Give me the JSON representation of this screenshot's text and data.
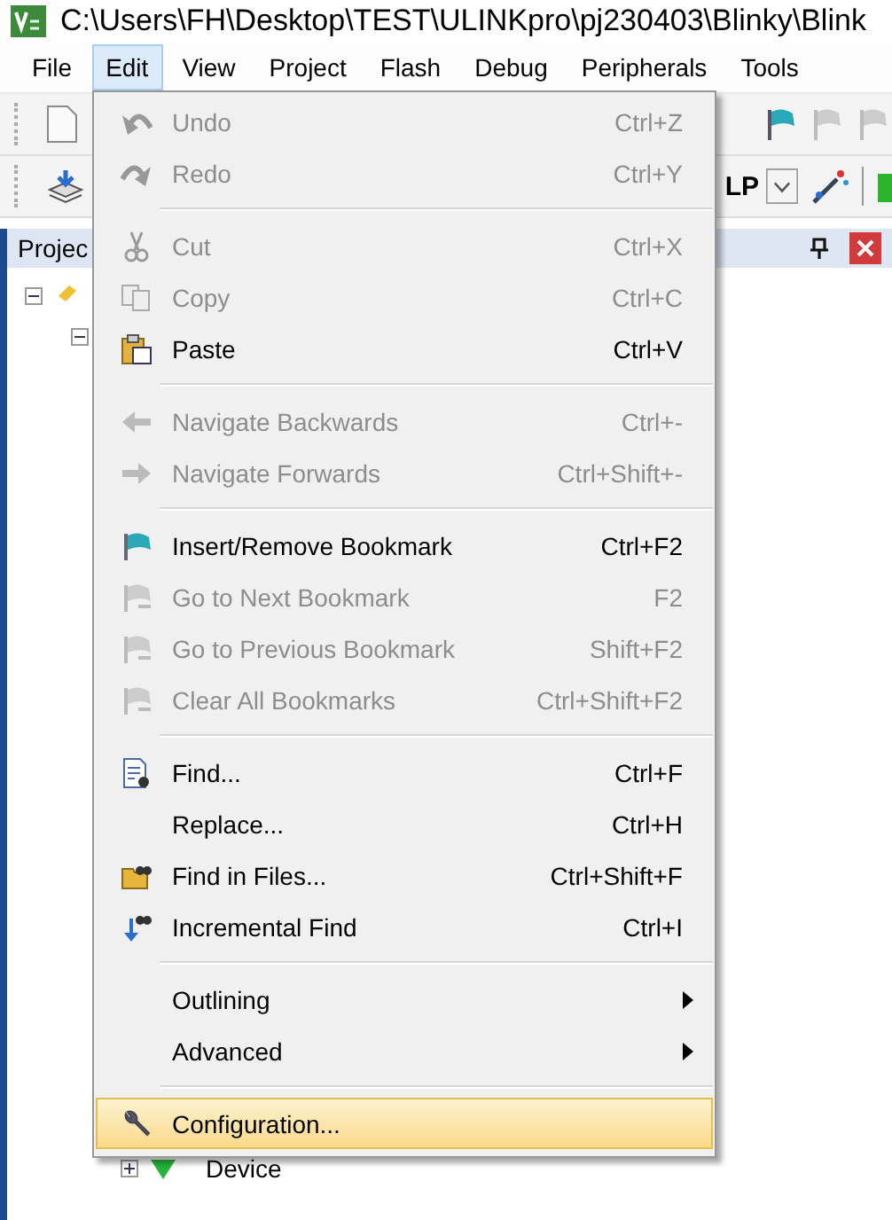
{
  "window": {
    "title": "C:\\Users\\FH\\Desktop\\TEST\\ULINKpro\\pj230403\\Blinky\\Blink"
  },
  "menubar": [
    {
      "label": "File",
      "selected": false
    },
    {
      "label": "Edit",
      "selected": true
    },
    {
      "label": "View",
      "selected": false
    },
    {
      "label": "Project",
      "selected": false
    },
    {
      "label": "Flash",
      "selected": false
    },
    {
      "label": "Debug",
      "selected": false
    },
    {
      "label": "Peripherals",
      "selected": false
    },
    {
      "label": "Tools",
      "selected": false
    }
  ],
  "toolbar": {
    "target_text": "LP"
  },
  "project_panel": {
    "title": "Projec"
  },
  "tree": [
    {
      "label": "Device",
      "expanded": false
    }
  ],
  "edit_menu": [
    {
      "kind": "command",
      "label": "Undo",
      "shortcut": "Ctrl+Z",
      "disabled": true,
      "selected": false
    },
    {
      "kind": "command",
      "label": "Redo",
      "shortcut": "Ctrl+Y",
      "disabled": true,
      "selected": false
    },
    {
      "kind": "separator"
    },
    {
      "kind": "command",
      "label": "Cut",
      "shortcut": "Ctrl+X",
      "disabled": true,
      "selected": false
    },
    {
      "kind": "command",
      "label": "Copy",
      "shortcut": "Ctrl+C",
      "disabled": true,
      "selected": false
    },
    {
      "kind": "command",
      "label": "Paste",
      "shortcut": "Ctrl+V",
      "disabled": false,
      "selected": false
    },
    {
      "kind": "separator"
    },
    {
      "kind": "command",
      "label": "Navigate Backwards",
      "shortcut": "Ctrl+-",
      "disabled": true,
      "selected": false
    },
    {
      "kind": "command",
      "label": "Navigate Forwards",
      "shortcut": "Ctrl+Shift+-",
      "disabled": true,
      "selected": false
    },
    {
      "kind": "separator"
    },
    {
      "kind": "command",
      "label": "Insert/Remove Bookmark",
      "shortcut": "Ctrl+F2",
      "disabled": false,
      "selected": false
    },
    {
      "kind": "command",
      "label": "Go to Next Bookmark",
      "shortcut": "F2",
      "disabled": true,
      "selected": false
    },
    {
      "kind": "command",
      "label": "Go to Previous Bookmark",
      "shortcut": "Shift+F2",
      "disabled": true,
      "selected": false
    },
    {
      "kind": "command",
      "label": "Clear All Bookmarks",
      "shortcut": "Ctrl+Shift+F2",
      "disabled": true,
      "selected": false
    },
    {
      "kind": "separator"
    },
    {
      "kind": "command",
      "label": "Find...",
      "shortcut": "Ctrl+F",
      "disabled": false,
      "selected": false
    },
    {
      "kind": "command",
      "label": "Replace...",
      "shortcut": "Ctrl+H",
      "disabled": false,
      "selected": false
    },
    {
      "kind": "command",
      "label": "Find in Files...",
      "shortcut": "Ctrl+Shift+F",
      "disabled": false,
      "selected": false
    },
    {
      "kind": "command",
      "label": "Incremental Find",
      "shortcut": "Ctrl+I",
      "disabled": false,
      "selected": false
    },
    {
      "kind": "separator"
    },
    {
      "kind": "submenu",
      "label": "Outlining",
      "disabled": false,
      "selected": false
    },
    {
      "kind": "submenu",
      "label": "Advanced",
      "disabled": false,
      "selected": false
    },
    {
      "kind": "separator"
    },
    {
      "kind": "command",
      "label": "Configuration...",
      "disabled": false,
      "selected": true
    }
  ]
}
